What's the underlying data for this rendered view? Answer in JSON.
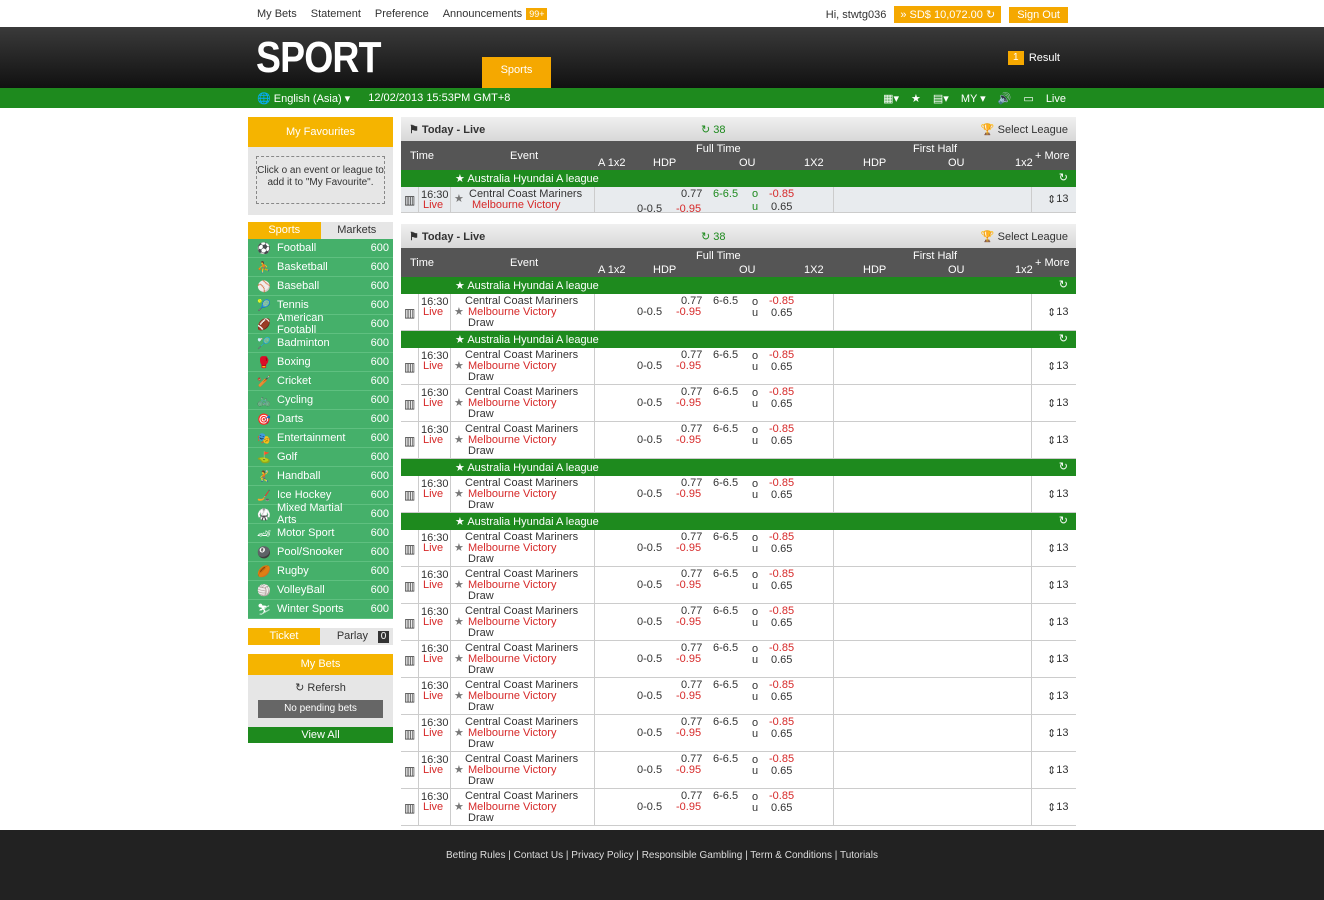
{
  "topnav": {
    "links": [
      "My Bets",
      "Statement",
      "Preference",
      "Announcements"
    ],
    "badge": "99+",
    "greeting": "Hi, stwtg036",
    "balance": "SD$ 10,072.00",
    "signout": "Sign Out"
  },
  "header": {
    "logo": "SPORT",
    "tab": "Sports",
    "result_count": "1",
    "result_label": "Result"
  },
  "greenbar": {
    "language": "English (Asia)",
    "datetime": "12/02/2013 15:53PM GMT+8",
    "odds": "MY",
    "live": "Live"
  },
  "sidebar": {
    "fav_title": "My Favourites",
    "fav_hint": "Click o an event or league to add it to \"My Favourite\".",
    "tab_sports": "Sports",
    "tab_markets": "Markets",
    "sports": [
      {
        "name": "Football",
        "count": "600"
      },
      {
        "name": "Basketball",
        "count": "600"
      },
      {
        "name": "Baseball",
        "count": "600"
      },
      {
        "name": "Tennis",
        "count": "600"
      },
      {
        "name": "American Footabll",
        "count": "600"
      },
      {
        "name": "Badminton",
        "count": "600"
      },
      {
        "name": "Boxing",
        "count": "600"
      },
      {
        "name": "Cricket",
        "count": "600"
      },
      {
        "name": "Cycling",
        "count": "600"
      },
      {
        "name": "Darts",
        "count": "600"
      },
      {
        "name": "Entertainment",
        "count": "600"
      },
      {
        "name": "Golf",
        "count": "600"
      },
      {
        "name": "Handball",
        "count": "600"
      },
      {
        "name": "Ice Hockey",
        "count": "600"
      },
      {
        "name": "Mixed Martial Arts",
        "count": "600"
      },
      {
        "name": "Motor Sport",
        "count": "600"
      },
      {
        "name": "Pool/Snooker",
        "count": "600"
      },
      {
        "name": "Rugby",
        "count": "600"
      },
      {
        "name": "VolleyBall",
        "count": "600"
      },
      {
        "name": "Winter Sports",
        "count": "600"
      }
    ],
    "ticket": "Ticket",
    "parlay": "Parlay",
    "parlay_count": "0",
    "mybets": "My Bets",
    "refresh": "Refersh",
    "no_pending": "No pending bets",
    "view_all": "View All"
  },
  "panel": {
    "title": "Today - Live",
    "count": "38",
    "select_league": "Select League"
  },
  "cols": {
    "time": "Time",
    "event": "Event",
    "full_time": "Full Time",
    "first_half": "First Half",
    "a1x2": "A 1x2",
    "hdp": "HDP",
    "ou": "OU",
    "x12": "1X2",
    "hdp2": "HDP",
    "ou2": "OU",
    "x12b": "1x2",
    "more": "+ More"
  },
  "league": "Australia Hyundai A league",
  "match": {
    "time": "16:30",
    "live": "Live",
    "home": "Central Coast Mariners",
    "away": "Melbourne Victory",
    "draw": "Draw",
    "h1": "0.77",
    "hcap": "0-0.5",
    "h2": "-0.95",
    "ou_line": "6-6.5",
    "o": "o",
    "u": "u",
    "o1": "-0.85",
    "u1": "0.65",
    "more": "13"
  },
  "footer": [
    "Betting Rules",
    "Contact Us",
    "Privacy Policy",
    "Responsible Gambling",
    "Term & Conditions",
    "Tutorials"
  ]
}
